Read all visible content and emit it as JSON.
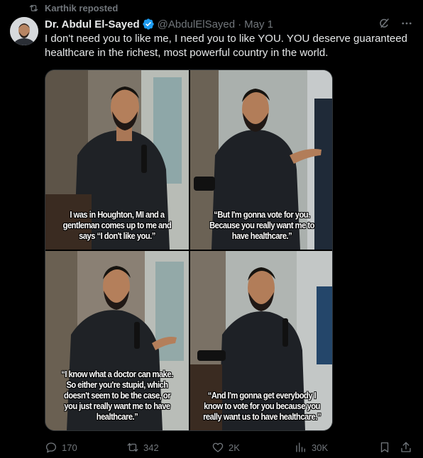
{
  "repost": {
    "label": "Karthik reposted"
  },
  "author": {
    "name": "Dr. Abdul El-Sayed",
    "handle": "@AbdulElSayed",
    "separator": "·",
    "date": "May 1"
  },
  "tweet": {
    "text": "I don't need you to like me, I need you to like YOU. YOU deserve guaranteed healthcare in the richest, most powerful country in the world."
  },
  "media": {
    "captions": [
      "I was in Houghton, MI and a gentleman comes up to me and says “I don't like you.”",
      "“But I'm gonna vote for you. Because you really want me to have healthcare.”",
      "“I know what a doctor can make. So either you're stupid, which doesn't seem to be the case, or you just really want me to have healthcare.”",
      "“And I'm gonna get everybody I know to vote for you because you really want us to have healthcare.”"
    ]
  },
  "actions": {
    "replies": "170",
    "reposts": "342",
    "likes": "2K",
    "views": "30K"
  },
  "colors": {
    "background": "#000000",
    "text": "#e7e9ea",
    "muted": "#71767b",
    "verified": "#1d9bf0"
  },
  "icons": {
    "repost": "repost-icon",
    "verified": "verified-badge-icon",
    "grok": "grok-icon",
    "more": "more-icon",
    "reply": "reply-icon",
    "like": "heart-icon",
    "views": "views-icon",
    "bookmark": "bookmark-icon",
    "share": "share-icon"
  }
}
